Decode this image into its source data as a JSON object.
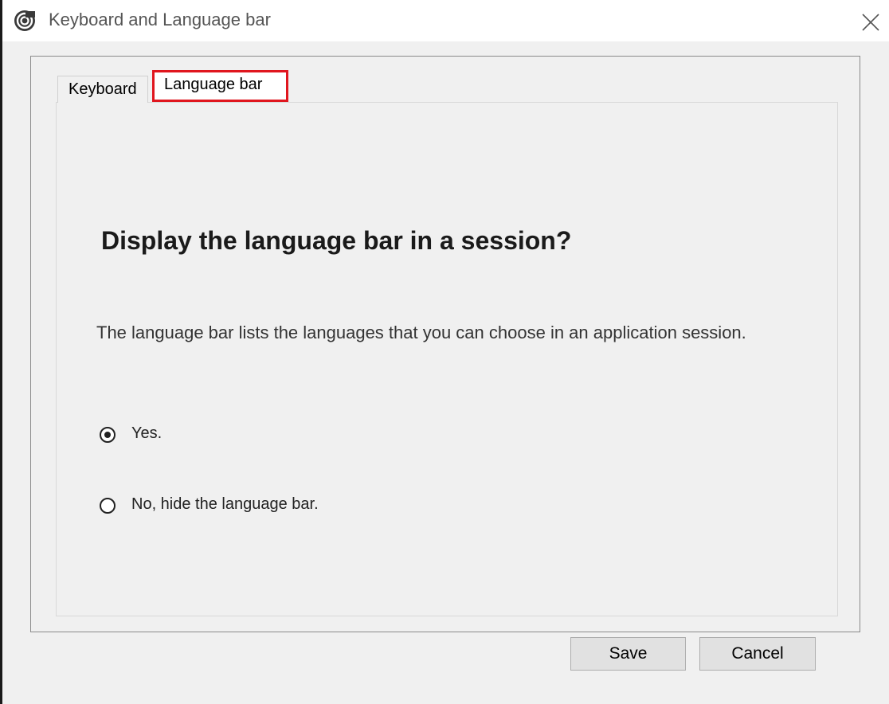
{
  "window": {
    "title": "Keyboard and Language bar",
    "app_icon": "citrix-swirl-icon",
    "close_icon": "close-icon"
  },
  "tabs": [
    {
      "label": "Keyboard",
      "selected": false
    },
    {
      "label": "Language bar",
      "selected": true,
      "highlighted": true
    }
  ],
  "panel": {
    "heading": "Display the language bar in a session?",
    "description": "The language bar lists the languages that you can choose in an application session.",
    "options": [
      {
        "label": "Yes.",
        "selected": true
      },
      {
        "label": "No, hide the language bar.",
        "selected": false
      }
    ]
  },
  "buttons": {
    "save": "Save",
    "cancel": "Cancel"
  },
  "colors": {
    "highlight_border": "#e0161e",
    "window_bg": "#f0f0f0"
  }
}
